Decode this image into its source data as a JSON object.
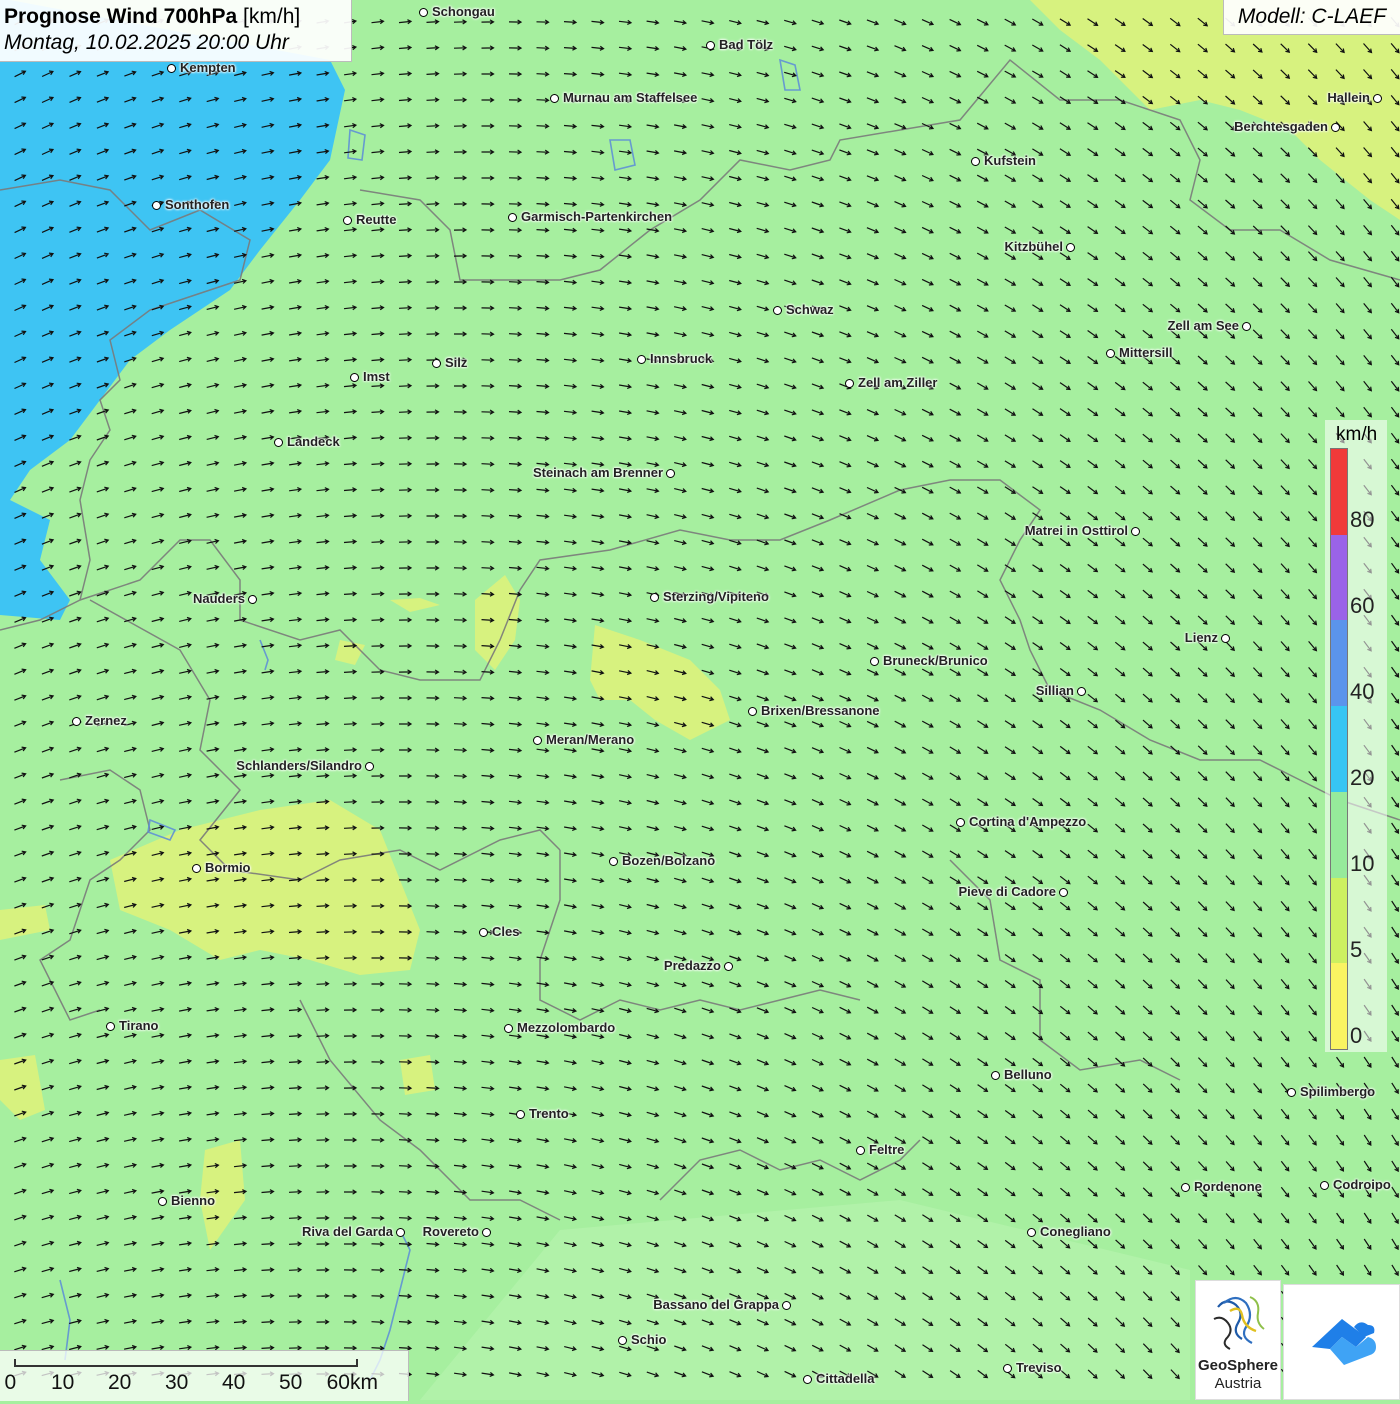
{
  "title": {
    "main": "Prognose Wind 700hPa",
    "unit": "[km/h]",
    "date": "Montag, 10.02.2025 20:00 Uhr"
  },
  "model": "Modell: C-LAEF",
  "legend": {
    "unit": "km/h",
    "ticks": [
      "80",
      "60",
      "40",
      "20",
      "10",
      "5",
      "0"
    ],
    "colors": [
      "#f03a3a",
      "#9a63e8",
      "#5b94ec",
      "#37c5f3",
      "#96ea9b",
      "#cdf060",
      "#faf462"
    ]
  },
  "scale": {
    "ticks": [
      "0",
      "10",
      "20",
      "30",
      "40",
      "50",
      "60km"
    ]
  },
  "logo": {
    "line1": "GeoSphere",
    "line2": "Austria"
  },
  "colors": {
    "calm_wind": "#a6ef9f",
    "light_wind": "#d7f27f",
    "strong_wind": "#3ec4f3",
    "arrow": "#111111",
    "border": "#7a7a7a"
  },
  "cities": [
    {
      "name": "Schongau",
      "side": "right"
    },
    {
      "name": "Bad Tölz",
      "side": "right"
    },
    {
      "name": "Kempten",
      "side": "right"
    },
    {
      "name": "Murnau am Staffelsee",
      "side": "right"
    },
    {
      "name": "Hallein",
      "side": "left"
    },
    {
      "name": "Berchtesgaden",
      "side": "left"
    },
    {
      "name": "Kufstein",
      "side": "right"
    },
    {
      "name": "Sonthofen",
      "side": "right"
    },
    {
      "name": "Reutte",
      "side": "right"
    },
    {
      "name": "Garmisch-Partenkirchen",
      "side": "right"
    },
    {
      "name": "Kitzbühel",
      "side": "left"
    },
    {
      "name": "Schwaz",
      "side": "right"
    },
    {
      "name": "Zell am See",
      "side": "left"
    },
    {
      "name": "Mittersill",
      "side": "right"
    },
    {
      "name": "Innsbruck",
      "side": "right"
    },
    {
      "name": "Silz",
      "side": "right"
    },
    {
      "name": "Imst",
      "side": "right"
    },
    {
      "name": "Zell am Ziller",
      "side": "right"
    },
    {
      "name": "Landeck",
      "side": "right"
    },
    {
      "name": "Steinach am Brenner",
      "side": "left"
    },
    {
      "name": "Matrei in Osttirol",
      "side": "left"
    },
    {
      "name": "Nauders",
      "side": "left"
    },
    {
      "name": "Sterzing/Vipiteno",
      "side": "right"
    },
    {
      "name": "Lienz",
      "side": "left"
    },
    {
      "name": "Bruneck/Brunico",
      "side": "right"
    },
    {
      "name": "Sillian",
      "side": "left"
    },
    {
      "name": "Brixen/Bressanone",
      "side": "right"
    },
    {
      "name": "Zernez",
      "side": "right"
    },
    {
      "name": "Meran/Merano",
      "side": "right"
    },
    {
      "name": "Schlanders/Silandro",
      "side": "left"
    },
    {
      "name": "Cortina d'Ampezzo",
      "side": "right"
    },
    {
      "name": "Bozen/Bolzano",
      "side": "right"
    },
    {
      "name": "Bormio",
      "side": "right"
    },
    {
      "name": "Pieve di Cadore",
      "side": "left"
    },
    {
      "name": "Cles",
      "side": "right"
    },
    {
      "name": "Predazzo",
      "side": "left"
    },
    {
      "name": "Tirano",
      "side": "right"
    },
    {
      "name": "Mezzolombardo",
      "side": "right"
    },
    {
      "name": "Belluno",
      "side": "right"
    },
    {
      "name": "Spilimbergo",
      "side": "right"
    },
    {
      "name": "Trento",
      "side": "right"
    },
    {
      "name": "Feltre",
      "side": "right"
    },
    {
      "name": "Pordenone",
      "side": "right"
    },
    {
      "name": "Codroipo",
      "side": "right"
    },
    {
      "name": "Bienno",
      "side": "right"
    },
    {
      "name": "Riva del Garda",
      "side": "left"
    },
    {
      "name": "Rovereto",
      "side": "left"
    },
    {
      "name": "Conegliano",
      "side": "right"
    },
    {
      "name": "Bassano del Grappa",
      "side": "left"
    },
    {
      "name": "Schio",
      "side": "right"
    },
    {
      "name": "Treviso",
      "side": "right"
    },
    {
      "name": "Cittadella",
      "side": "right"
    }
  ]
}
